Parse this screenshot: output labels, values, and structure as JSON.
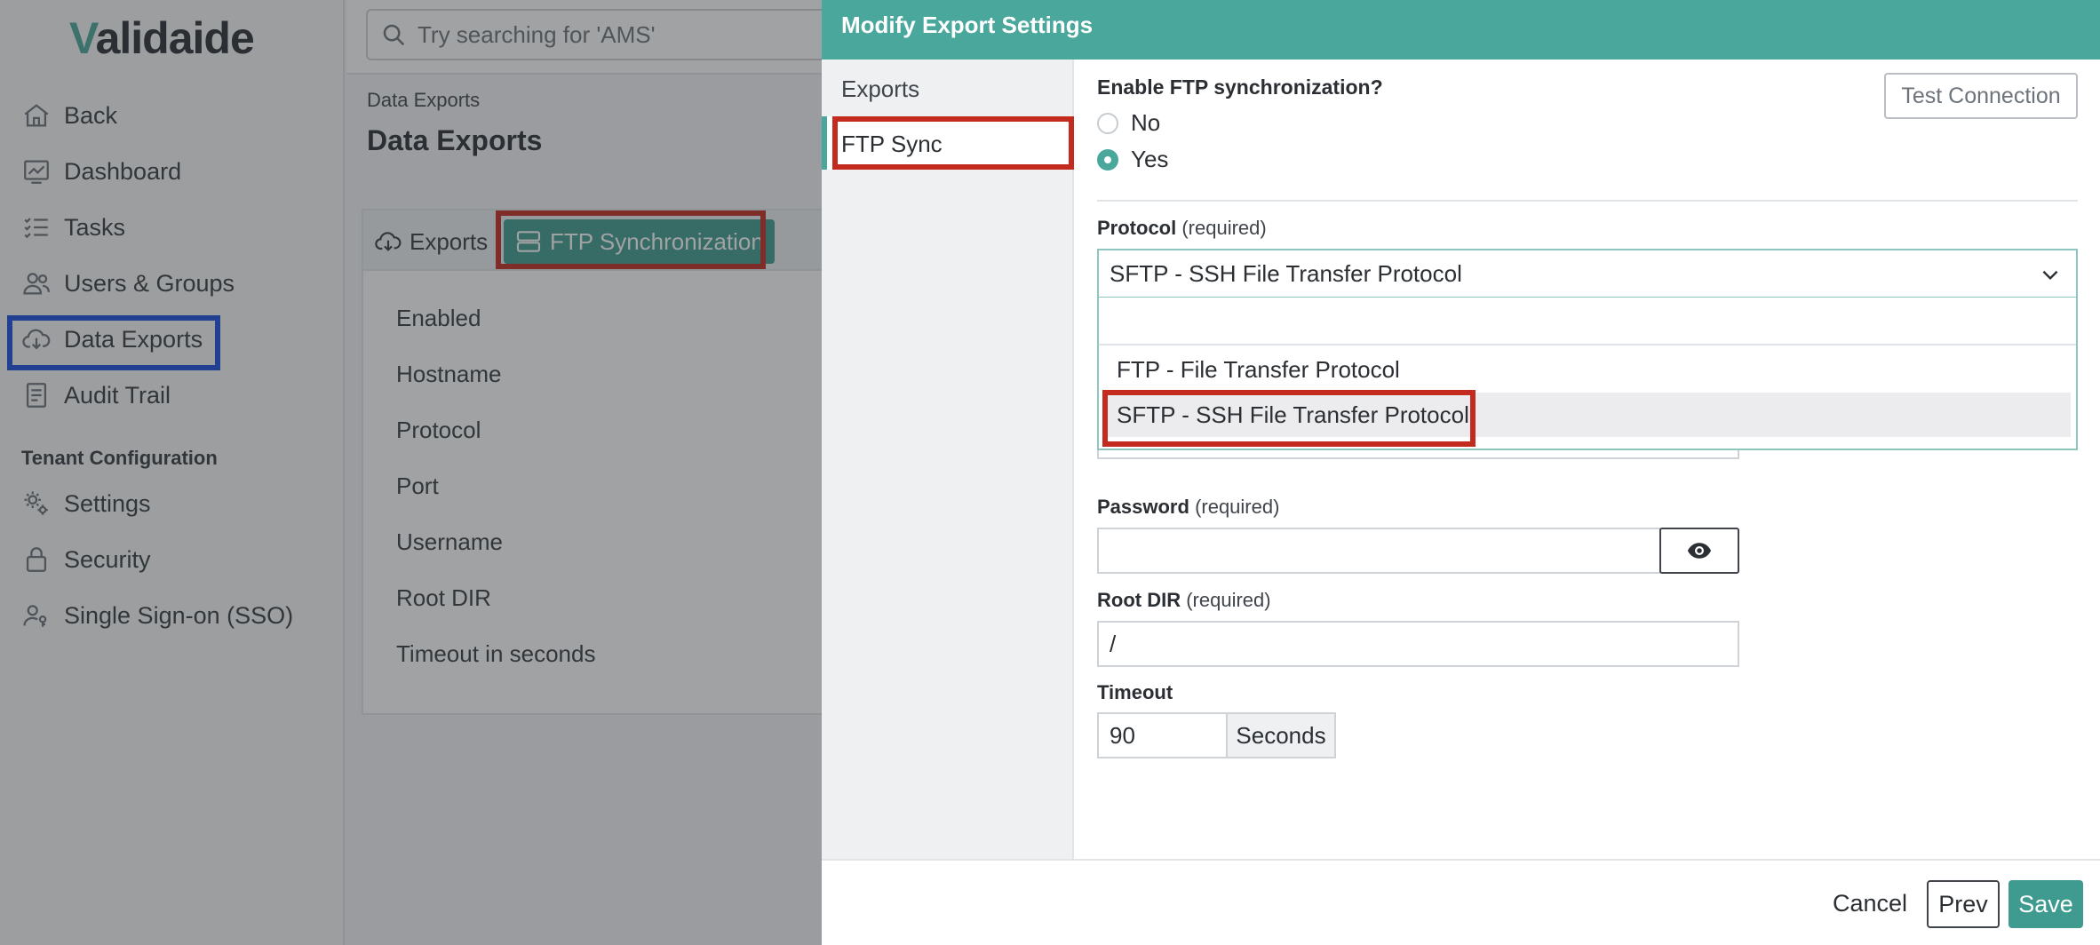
{
  "app": {
    "logo_text": "alidaide",
    "logo_first": "V"
  },
  "search": {
    "placeholder": "Try searching for 'AMS'"
  },
  "sidebar": {
    "items": [
      {
        "label": "Back",
        "icon": "home-icon"
      },
      {
        "label": "Dashboard",
        "icon": "dashboard-icon"
      },
      {
        "label": "Tasks",
        "icon": "tasks-icon"
      },
      {
        "label": "Users & Groups",
        "icon": "users-icon"
      },
      {
        "label": "Data Exports",
        "icon": "cloud-download-icon"
      },
      {
        "label": "Audit Trail",
        "icon": "audit-icon"
      }
    ],
    "section_title": "Tenant Configuration",
    "tenant_items": [
      {
        "label": "Settings",
        "icon": "gears-icon"
      },
      {
        "label": "Security",
        "icon": "lock-icon"
      },
      {
        "label": "Single Sign-on (SSO)",
        "icon": "user-key-icon"
      }
    ]
  },
  "main": {
    "breadcrumb": "Data Exports",
    "title": "Data Exports",
    "tabs": [
      {
        "label": "Exports",
        "icon": "cloud-download-icon"
      },
      {
        "label": "FTP Synchronization",
        "icon": "server-icon"
      }
    ],
    "fields": [
      "Enabled",
      "Hostname",
      "Protocol",
      "Port",
      "Username",
      "Root DIR",
      "Timeout in seconds"
    ]
  },
  "modal": {
    "title": "Modify Export Settings",
    "side_items": [
      "Exports",
      "FTP Sync"
    ],
    "enable_question": "Enable FTP synchronization?",
    "test_connection": "Test Connection",
    "radio_options": [
      "No",
      "Yes"
    ],
    "selected_radio": "Yes",
    "protocol_label": "Protocol",
    "required_text": "(required)",
    "protocol_value": "SFTP - SSH File Transfer Protocol",
    "protocol_options": [
      "FTP - File Transfer Protocol",
      "SFTP - SSH File Transfer Protocol"
    ],
    "password_label": "Password",
    "root_dir_label": "Root DIR",
    "root_dir_value": "/",
    "timeout_label": "Timeout",
    "timeout_value": "90",
    "timeout_unit": "Seconds",
    "cancel": "Cancel",
    "prev": "Prev",
    "save": "Save"
  },
  "colors": {
    "accent": "#4aa79c",
    "highlight_red": "#c42b1f",
    "highlight_blue": "#1a4ee0"
  }
}
